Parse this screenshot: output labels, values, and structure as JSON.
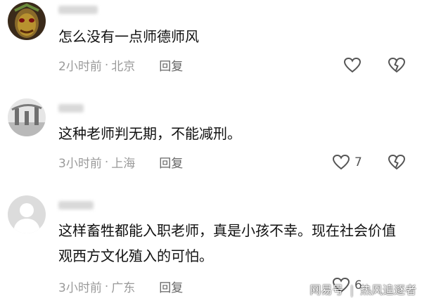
{
  "comments": [
    {
      "text": "怎么没有一点师德师风",
      "time": "2小时前",
      "location": "北京",
      "reply": "回复",
      "likes": ""
    },
    {
      "text": "这种老师判无期，不能减刑。",
      "time": "3小时前",
      "location": "上海",
      "reply": "回复",
      "likes": "7"
    },
    {
      "text": "这样畜牲都能入职老师，真是小孩不幸。现在社会价值观西方文化殖入的可怕。",
      "time": "3小时前",
      "location": "广东",
      "reply": "回复",
      "likes": "6"
    }
  ],
  "meta_separator": "·",
  "watermark": {
    "brand": "网易号",
    "separator": "|",
    "author": "热风追逐者"
  },
  "icons": {
    "like": "heart-outline-icon",
    "dislike": "broken-heart-icon"
  },
  "colors": {
    "meta_text": "#9a9a9a",
    "reply_text": "#666666",
    "icon_stroke": "#555555"
  }
}
